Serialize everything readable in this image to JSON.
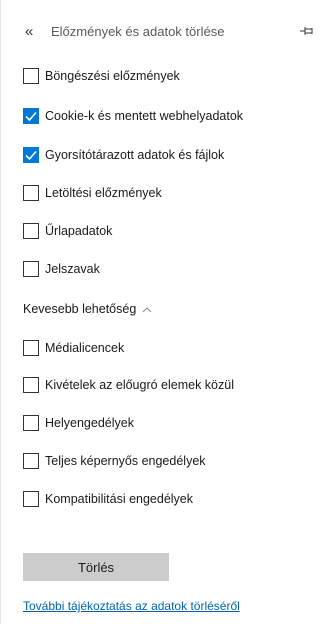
{
  "header": {
    "back_glyph": "«",
    "title": "Előzmények és adatok törlése",
    "pin_icon": "pin-icon"
  },
  "options_primary": [
    {
      "label": "Böngészési előzmények",
      "checked": false
    },
    {
      "label": "Cookie-k és mentett webhelyadatok",
      "checked": true
    },
    {
      "label": "Gyorsítótárazott adatok és fájlok",
      "checked": true
    },
    {
      "label": "Letöltési előzmények",
      "checked": false
    },
    {
      "label": "Űrlapadatok",
      "checked": false
    },
    {
      "label": "Jelszavak",
      "checked": false
    }
  ],
  "toggle_less": {
    "label": "Kevesebb lehetőség",
    "icon": "chevron-up-icon"
  },
  "options_more": [
    {
      "label": "Médialicencek",
      "checked": false
    },
    {
      "label": "Kivételek az előugró elemek közül",
      "checked": false
    },
    {
      "label": "Helyengedélyek",
      "checked": false
    },
    {
      "label": "Teljes képernyős engedélyek",
      "checked": false
    },
    {
      "label": "Kompatibilitási engedélyek",
      "checked": false
    }
  ],
  "clear_button": {
    "label": "Törlés"
  },
  "learn_more_link": {
    "label": "További tájékoztatás az adatok törléséről"
  },
  "colors": {
    "accent": "#0078d7",
    "link": "#0063b1",
    "button_bg": "#cccccc"
  }
}
